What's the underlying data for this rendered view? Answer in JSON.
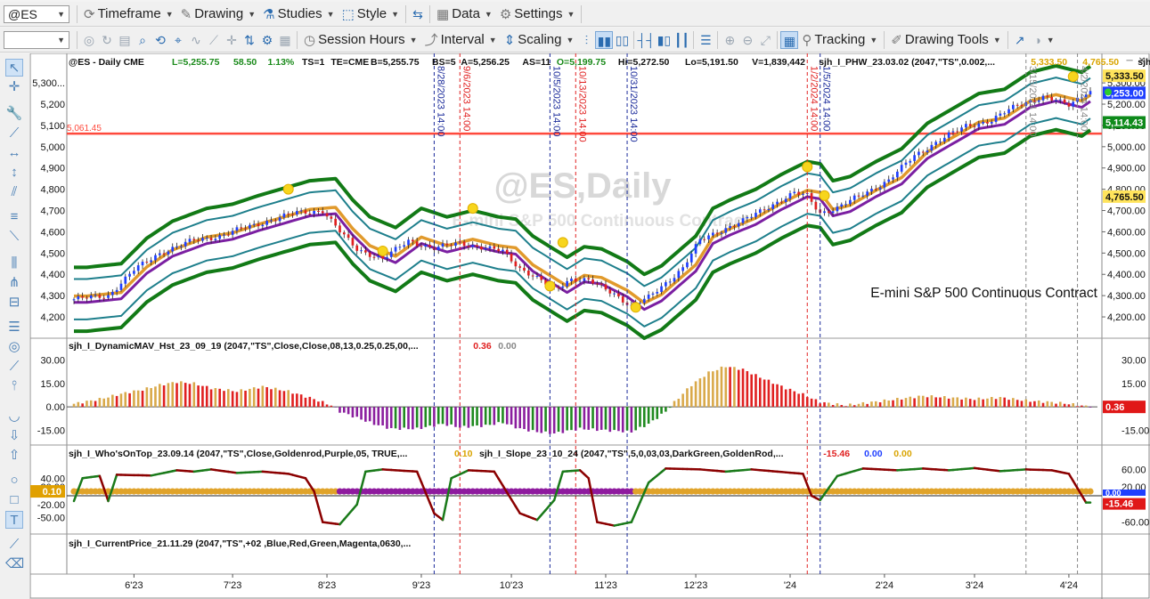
{
  "toolbar1": {
    "symbol": "@ES",
    "timeframe": "Timeframe",
    "drawing": "Drawing",
    "studies": "Studies",
    "style": "Style",
    "data": "Data",
    "settings": "Settings"
  },
  "toolbar2": {
    "session_hours": "Session Hours",
    "interval": "Interval",
    "scaling": "Scaling",
    "tracking": "Tracking",
    "drawing_tools": "Drawing Tools"
  },
  "chart_data": {
    "type": "line",
    "symbol_info": "@ES - Daily  CME",
    "status_fields": [
      {
        "text": "L=5,255.75",
        "color": "#1a8a1a"
      },
      {
        "text": "58.50",
        "color": "#1a8a1a"
      },
      {
        "text": "1.13%",
        "color": "#1a8a1a"
      },
      {
        "text": "TS=1",
        "color": "#111"
      },
      {
        "text": "TE=CME",
        "color": "#111"
      },
      {
        "text": "B=5,255.75",
        "color": "#111"
      },
      {
        "text": "BS=5",
        "color": "#111"
      },
      {
        "text": "A=5,256.25",
        "color": "#111"
      },
      {
        "text": "AS=11",
        "color": "#111"
      },
      {
        "text": "O=5,199.75",
        "color": "#1a8a1a"
      },
      {
        "text": "Hi=5,272.50",
        "color": "#111"
      },
      {
        "text": "Lo=5,191.50",
        "color": "#111"
      },
      {
        "text": "V=1,839,442",
        "color": "#111"
      }
    ],
    "overlay_study": "sjh_I_PHW_23.03.02 (2047,\"TS\",0.002,...",
    "overlay_values": [
      {
        "text": "5,333.50",
        "color": "#d9a400"
      },
      {
        "text": "4,765.50",
        "color": "#d9a400"
      }
    ],
    "overlay_study2": "sjh_I_SunnyBa...",
    "watermark": "@ES,Daily",
    "watermark_sub": "E-mini S&P 500 Continuous Contract",
    "chart_label": "E-mini S&P 500 Continuous Contract",
    "hline": {
      "value": 5061.45,
      "label": "5,061.45",
      "color": "#ff4a3d"
    },
    "price_axis": {
      "min": 4150,
      "max": 5380,
      "ticks": [
        "4,200.00",
        "4,300.00",
        "4,400.00",
        "4,500.00",
        "4,600.00",
        "4,700.00",
        "4,800.00",
        "4,900.00",
        "5,000.00",
        "5,100.00",
        "5,200.00",
        "5,300.00"
      ]
    },
    "price_left_ticks": [
      "4,200",
      "4,300",
      "4,400",
      "4,500",
      "4,600",
      "4,700",
      "4,800",
      "4,900",
      "5,000",
      "5,100",
      "5,200",
      "5,300..."
    ],
    "price_tags": [
      {
        "text": "5,333.50",
        "bg": "#ffe45c",
        "fg": "#111",
        "value": 5333.5
      },
      {
        "text": "5,253.00",
        "bg": "#1f3fff",
        "fg": "#fff",
        "value": 5253
      },
      {
        "text": "5,114.43",
        "bg": "#0d8a1a",
        "fg": "#fff",
        "value": 5114.43
      },
      {
        "text": "4,765.50",
        "bg": "#ffe45c",
        "fg": "#111",
        "value": 4765.5
      }
    ],
    "date_axis": [
      "6'23",
      "7'23",
      "8'23",
      "9'23",
      "10'23",
      "11'23",
      "12'23",
      "'24",
      "2'24",
      "3'24",
      "4'24"
    ],
    "vlines": [
      {
        "label": "8/28/2023 14:00",
        "color": "#1a2a9a",
        "bar": 84
      },
      {
        "label": "9/6/2023 14:00",
        "color": "#e02020",
        "bar": 90
      },
      {
        "label": "10/5/2023 14:00",
        "color": "#1a2a9a",
        "bar": 111
      },
      {
        "label": "10/13/2023 14:00",
        "color": "#e02020",
        "bar": 117
      },
      {
        "label": "10/31/2023 14:00",
        "color": "#1a2a9a",
        "bar": 129
      },
      {
        "label": "1/2/2024 14:00",
        "color": "#e02020",
        "bar": 171
      },
      {
        "label": "1/5/2024 14:00",
        "color": "#1a2a9a",
        "bar": 174
      },
      {
        "label": "3/15/2024 14:00",
        "color": "#888888",
        "bar": 222
      },
      {
        "label": "4/2/2024 14:00",
        "color": "#888888",
        "bar": 234
      }
    ],
    "close_anchors": [
      [
        0,
        4283
      ],
      [
        8,
        4300
      ],
      [
        14,
        4420
      ],
      [
        20,
        4500
      ],
      [
        28,
        4560
      ],
      [
        34,
        4580
      ],
      [
        40,
        4620
      ],
      [
        46,
        4655
      ],
      [
        52,
        4690
      ],
      [
        58,
        4700
      ],
      [
        62,
        4600
      ],
      [
        66,
        4520
      ],
      [
        72,
        4470
      ],
      [
        78,
        4560
      ],
      [
        84,
        4520
      ],
      [
        90,
        4550
      ],
      [
        96,
        4520
      ],
      [
        100,
        4510
      ],
      [
        104,
        4430
      ],
      [
        108,
        4380
      ],
      [
        112,
        4330
      ],
      [
        116,
        4380
      ],
      [
        120,
        4370
      ],
      [
        126,
        4310
      ],
      [
        130,
        4250
      ],
      [
        134,
        4290
      ],
      [
        138,
        4360
      ],
      [
        142,
        4430
      ],
      [
        146,
        4560
      ],
      [
        150,
        4600
      ],
      [
        156,
        4650
      ],
      [
        162,
        4720
      ],
      [
        168,
        4780
      ],
      [
        171,
        4770
      ],
      [
        174,
        4690
      ],
      [
        178,
        4710
      ],
      [
        184,
        4780
      ],
      [
        190,
        4840
      ],
      [
        196,
        4960
      ],
      [
        202,
        5030
      ],
      [
        208,
        5100
      ],
      [
        214,
        5120
      ],
      [
        220,
        5200
      ],
      [
        226,
        5230
      ],
      [
        232,
        5200
      ],
      [
        236,
        5255.75
      ]
    ],
    "dots": [
      {
        "bar": 50,
        "value": 4800
      },
      {
        "bar": 72,
        "value": 4510
      },
      {
        "bar": 93,
        "value": 4710
      },
      {
        "bar": 111,
        "value": 4345
      },
      {
        "bar": 114,
        "value": 4550
      },
      {
        "bar": 131,
        "value": 4245
      },
      {
        "bar": 171,
        "value": 4905
      },
      {
        "bar": 175,
        "value": 4770
      },
      {
        "bar": 233,
        "value": 5330
      }
    ],
    "histogram": {
      "name": "sjh_I_DynamicMAV_Hst_23_09_19 (2047,\"TS\",Close,Close,08,13,0.25,0.25,00,...",
      "last_values": [
        {
          "text": "0.36",
          "color": "#e02020"
        },
        {
          "text": "0.00",
          "color": "#888888"
        }
      ],
      "axis_ticks": [
        "30.00",
        "15.00",
        "0.00",
        "-15.00"
      ],
      "right_ticks": [
        "30.00",
        "15.00",
        "-15.00"
      ],
      "tag": {
        "text": "0.36",
        "bg": "#e01818",
        "fg": "#fff"
      },
      "range": [
        -21,
        36
      ],
      "anchors": [
        [
          0,
          2
        ],
        [
          6,
          5
        ],
        [
          12,
          9
        ],
        [
          16,
          11
        ],
        [
          20,
          14
        ],
        [
          24,
          16
        ],
        [
          28,
          15
        ],
        [
          32,
          12
        ],
        [
          38,
          10
        ],
        [
          44,
          13
        ],
        [
          50,
          10
        ],
        [
          56,
          5
        ],
        [
          60,
          1
        ],
        [
          62,
          -3
        ],
        [
          66,
          -7
        ],
        [
          70,
          -11
        ],
        [
          74,
          -14
        ],
        [
          80,
          -14
        ],
        [
          86,
          -11
        ],
        [
          90,
          -13
        ],
        [
          96,
          -12
        ],
        [
          100,
          -10
        ],
        [
          104,
          -14
        ],
        [
          108,
          -16
        ],
        [
          112,
          -17
        ],
        [
          118,
          -14
        ],
        [
          124,
          -15
        ],
        [
          130,
          -16
        ],
        [
          134,
          -11
        ],
        [
          138,
          -3
        ],
        [
          140,
          3
        ],
        [
          144,
          14
        ],
        [
          148,
          22
        ],
        [
          152,
          26
        ],
        [
          156,
          24
        ],
        [
          160,
          19
        ],
        [
          166,
          12
        ],
        [
          170,
          8
        ],
        [
          174,
          3
        ],
        [
          180,
          1
        ],
        [
          186,
          3
        ],
        [
          192,
          5
        ],
        [
          198,
          7
        ],
        [
          204,
          6
        ],
        [
          210,
          5
        ],
        [
          216,
          6
        ],
        [
          222,
          4
        ],
        [
          228,
          3
        ],
        [
          232,
          2
        ],
        [
          236,
          0.36
        ]
      ]
    },
    "oscillator": {
      "name1": "sjh_I_Who'sOnTop_23.09.14 (2047,\"TS\",Close,Goldenrod,Purple,05,  TRUE,...",
      "val1": {
        "text": "0.10",
        "color": "#d9a400"
      },
      "name2": "sjh_I_Slope_23_10_24 (2047,\"TS\",5,0,03,03,DarkGreen,GoldenRod,...",
      "val2": [
        {
          "text": "-15.46",
          "color": "#e02020"
        },
        {
          "text": "0.00",
          "color": "#1f3fff"
        },
        {
          "text": "0.00",
          "color": "#d9a400"
        }
      ],
      "left_ticks": [
        "40.00",
        "20.00",
        "-20.00",
        "-50.00"
      ],
      "right_ticks": [
        "60.00",
        "20.00",
        "-60.00"
      ],
      "left_tag": {
        "text": "0.10",
        "bg": "#e0a000",
        "fg": "#fff"
      },
      "right_tags": [
        {
          "text": "0.00",
          "bg": "#1f3fff",
          "fg": "#fff"
        },
        {
          "text": "-15.46",
          "bg": "#e01818",
          "fg": "#fff"
        }
      ],
      "range": [
        -75,
        75
      ],
      "anchors": [
        [
          0,
          -12
        ],
        [
          2,
          40
        ],
        [
          6,
          45
        ],
        [
          8,
          -12
        ],
        [
          10,
          48
        ],
        [
          18,
          46
        ],
        [
          24,
          58
        ],
        [
          28,
          55
        ],
        [
          32,
          60
        ],
        [
          38,
          52
        ],
        [
          44,
          55
        ],
        [
          50,
          50
        ],
        [
          54,
          40
        ],
        [
          56,
          10
        ],
        [
          58,
          -60
        ],
        [
          62,
          -65
        ],
        [
          66,
          -20
        ],
        [
          68,
          55
        ],
        [
          72,
          60
        ],
        [
          80,
          55
        ],
        [
          84,
          -40
        ],
        [
          86,
          -55
        ],
        [
          88,
          40
        ],
        [
          92,
          58
        ],
        [
          98,
          55
        ],
        [
          104,
          -40
        ],
        [
          108,
          -55
        ],
        [
          112,
          -10
        ],
        [
          114,
          55
        ],
        [
          118,
          58
        ],
        [
          120,
          40
        ],
        [
          122,
          -60
        ],
        [
          126,
          -68
        ],
        [
          130,
          -60
        ],
        [
          134,
          30
        ],
        [
          138,
          62
        ],
        [
          146,
          60
        ],
        [
          152,
          55
        ],
        [
          158,
          60
        ],
        [
          164,
          55
        ],
        [
          170,
          50
        ],
        [
          172,
          0
        ],
        [
          174,
          -10
        ],
        [
          178,
          45
        ],
        [
          184,
          62
        ],
        [
          192,
          58
        ],
        [
          198,
          62
        ],
        [
          204,
          58
        ],
        [
          210,
          63
        ],
        [
          216,
          56
        ],
        [
          222,
          60
        ],
        [
          228,
          58
        ],
        [
          232,
          50
        ],
        [
          236,
          -15.46
        ]
      ]
    },
    "current_price_study": "sjh_I_CurrentPrice_21.11.29 (2047,\"TS\",+02 ,Blue,Red,Green,Magenta,0630,..."
  }
}
